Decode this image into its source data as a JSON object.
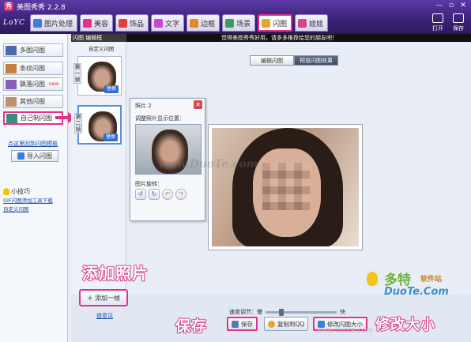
{
  "window": {
    "title": "美图秀秀 2.2.8",
    "logo": "LoYC",
    "controls": [
      "—",
      "▫",
      "✕"
    ]
  },
  "tabs": [
    {
      "label": "图片处理",
      "icon": "image-edit-icon",
      "color": "#3d7fd6"
    },
    {
      "label": "美容",
      "icon": "beauty-icon",
      "color": "#e2328c"
    },
    {
      "label": "饰品",
      "icon": "heart-icon",
      "color": "#e0423a"
    },
    {
      "label": "文字",
      "icon": "text-icon",
      "color": "#c44bd0"
    },
    {
      "label": "边框",
      "icon": "frame-icon",
      "color": "#e28a2a"
    },
    {
      "label": "场景",
      "icon": "scene-icon",
      "color": "#3a9d5c"
    },
    {
      "label": "闪图",
      "icon": "flash-icon",
      "color": "#e2a72a",
      "active": true
    },
    {
      "label": "娃娃",
      "icon": "doll-icon",
      "color": "#d4468a"
    }
  ],
  "toptools": {
    "open_label": "打开",
    "save_label": "保存"
  },
  "sidebar": {
    "items": [
      {
        "label": "多图闪图",
        "thumb": "#4c6dad"
      },
      {
        "label": "条纹闪图",
        "thumb": "#c57f3c"
      },
      {
        "label": "飘落闪图",
        "thumb": "#8a5fb8",
        "badge": "new"
      },
      {
        "label": "其他闪图",
        "thumb": "#c28e6f"
      },
      {
        "label": "自己制闪图",
        "thumb": "#3a8f7a",
        "selected": true
      }
    ],
    "link_text": "点这里回到闪图模板",
    "import_label": "导入闪图",
    "tips_title": "小技巧",
    "tips_links": [
      "GIF闪图添加工具下载",
      "自定义闪图"
    ]
  },
  "framepanel": {
    "title": "闪图 编辑框",
    "caption": "自定义闪图",
    "frames": [
      {
        "num_label": "第一帧",
        "swap_label": "替换"
      },
      {
        "num_label": "第二帧",
        "swap_label": "替换"
      }
    ]
  },
  "header_text": "觉得美图秀秀好用，请多多推荐给您的朋友吧！",
  "subtabs": [
    "编辑闪图",
    "预览闪图效果"
  ],
  "popup": {
    "title": "照片 2",
    "position_label": "调整照片显示位置：",
    "rotate_label": "图片旋转：",
    "rotate_buttons": [
      "↺",
      "↻",
      "↶",
      "↷"
    ],
    "close": "✕"
  },
  "watermark": "www.DuoTe.com",
  "speed": {
    "label": "速度调节：慢",
    "fast_label": "快",
    "level": 0.2
  },
  "buttons": {
    "add_frame": "添加一帧",
    "feedback": "提意见",
    "save": "保存",
    "copy_qq": "复制到QQ",
    "resize": "修改闪图大小"
  },
  "annotations": {
    "add_photo": "添加照片",
    "save": "保存",
    "resize": "修改大小"
  },
  "site_logo": {
    "name_zh": "多特",
    "name_suffix": "软件站",
    "name_en": "DuoTe.Com"
  },
  "bottom_faded_text": "www.duote.com"
}
